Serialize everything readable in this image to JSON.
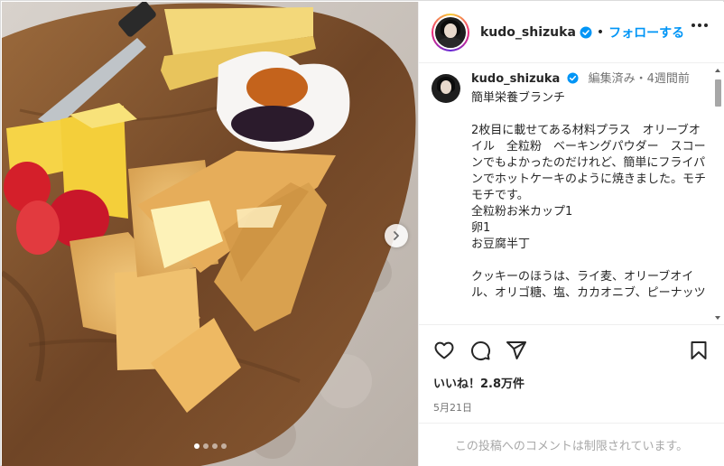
{
  "post": {
    "username": "kudo_shizuka",
    "follow_label": "フォローする",
    "separator": "•",
    "caption": {
      "username": "kudo_shizuka",
      "edited": "編集済み",
      "dot": "・",
      "time_ago": "4週間前",
      "text": "簡単栄養ブランチ\n\n2枚目に載せてある材料プラス　オリーブオイル　全粒粉　ベーキングパウダー　スコーンでもよかったのだけれど、簡単にフライパンでホットケーキのように焼きました。モチモチです。\n全粒粉お米カップ1\n卵1\nお豆腐半丁\n\nクッキーのほうは、ライ麦、オリーブオイル、オリゴ糖、塩、カカオニブ、ピーナッツ"
    },
    "likes": "いいね！2.8万件",
    "date": "5月21日",
    "comments_disabled": "この投稿へのコメントは制限されています。",
    "carousel": {
      "count": 4,
      "active": 0
    }
  },
  "colors": {
    "accent": "#0095f6",
    "verified": "#0095f6",
    "muted": "#737373"
  },
  "icons": [
    "verified-badge-icon",
    "more-options-icon",
    "heart-icon",
    "comment-icon",
    "share-icon",
    "bookmark-icon",
    "chevron-right-icon"
  ]
}
